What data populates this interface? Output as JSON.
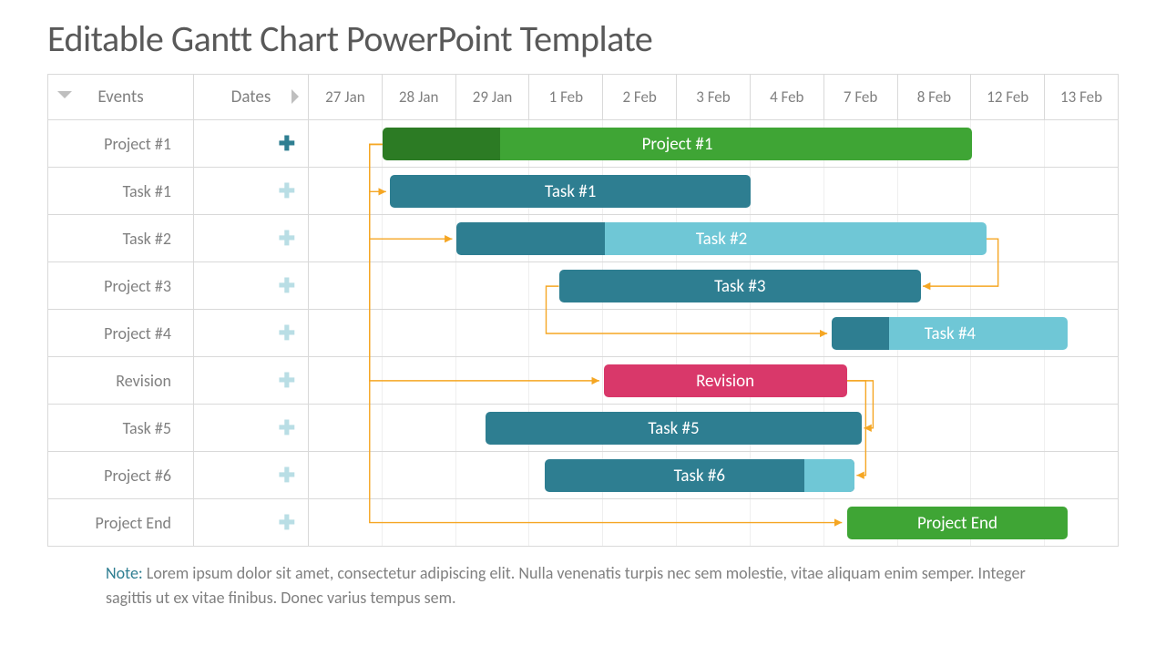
{
  "title": "Editable Gantt Chart PowerPoint Template",
  "columns": {
    "events": "Events",
    "dates": "Dates",
    "timeline": [
      "27 Jan",
      "28 Jan",
      "29 Jan",
      "1 Feb",
      "2 Feb",
      "3 Feb",
      "4 Feb",
      "7 Feb",
      "8 Feb",
      "12 Feb",
      "13 Feb"
    ]
  },
  "rows": [
    {
      "label": "Project #1",
      "plus": "dark"
    },
    {
      "label": "Task #1",
      "plus": "light"
    },
    {
      "label": "Task #2",
      "plus": "light"
    },
    {
      "label": "Project #3",
      "plus": "light"
    },
    {
      "label": "Project #4",
      "plus": "light"
    },
    {
      "label": "Revision",
      "plus": "light"
    },
    {
      "label": "Task #5",
      "plus": "light"
    },
    {
      "label": "Project #6",
      "plus": "light"
    },
    {
      "label": "Project End",
      "plus": "light"
    }
  ],
  "chart_data": {
    "type": "gantt",
    "categories": [
      "27 Jan",
      "28 Jan",
      "29 Jan",
      "1 Feb",
      "2 Feb",
      "3 Feb",
      "4 Feb",
      "7 Feb",
      "8 Feb",
      "12 Feb",
      "13 Feb"
    ],
    "bars": [
      {
        "row": 0,
        "label": "Project #1",
        "start": 1.0,
        "end": 9.0,
        "color": "#3fa535",
        "progress": 0.2,
        "progressColor": "#2c7b24"
      },
      {
        "row": 1,
        "label": "Task #1",
        "start": 1.1,
        "end": 6.0,
        "color": "#2e7e91",
        "progress": 0,
        "progressColor": "#2e7e91"
      },
      {
        "row": 2,
        "label": "Task #2",
        "start": 2.0,
        "end": 9.2,
        "color": "#6fc7d6",
        "progress": 0.28,
        "progressColor": "#2e7e91"
      },
      {
        "row": 3,
        "label": "Task #3",
        "start": 3.4,
        "end": 8.3,
        "color": "#2e7e91",
        "progress": 0,
        "progressColor": "#2e7e91"
      },
      {
        "row": 4,
        "label": "Task #4",
        "start": 7.1,
        "end": 10.3,
        "color": "#6fc7d6",
        "progress": 0.24,
        "progressColor": "#2e7e91"
      },
      {
        "row": 5,
        "label": "Revision",
        "start": 4.0,
        "end": 7.3,
        "color": "#d9386a",
        "progress": 0,
        "progressColor": "#d9386a"
      },
      {
        "row": 6,
        "label": "Task #5",
        "start": 2.4,
        "end": 7.5,
        "color": "#2e7e91",
        "progress": 0,
        "progressColor": "#2e7e91"
      },
      {
        "row": 7,
        "label": "Task #6",
        "start": 3.2,
        "end": 7.4,
        "color": "#2e7e91",
        "progress": 0,
        "progressColor": "#2e7e91",
        "tail": 0.16,
        "tailColor": "#6fc7d6"
      },
      {
        "row": 8,
        "label": "Project End",
        "start": 7.3,
        "end": 10.3,
        "color": "#3fa535",
        "progress": 0,
        "progressColor": "#3fa535"
      }
    ],
    "connectors": [
      {
        "from": {
          "row": 0,
          "col": 1.0,
          "side": "start"
        },
        "to": {
          "row": 1,
          "col": 1.1,
          "side": "start"
        }
      },
      {
        "from": {
          "row": 0,
          "col": 1.0,
          "side": "start"
        },
        "to": {
          "row": 2,
          "col": 2.0,
          "side": "start"
        }
      },
      {
        "from": {
          "row": 0,
          "col": 1.0,
          "side": "start"
        },
        "to": {
          "row": 5,
          "col": 4.0,
          "side": "start"
        }
      },
      {
        "from": {
          "row": 0,
          "col": 1.0,
          "side": "start"
        },
        "to": {
          "row": 8,
          "col": 7.3,
          "side": "start"
        }
      },
      {
        "from": {
          "row": 2,
          "col": 9.2,
          "side": "end"
        },
        "to": {
          "row": 3,
          "col": 8.3,
          "side": "end"
        }
      },
      {
        "from": {
          "row": 3,
          "col": 3.4,
          "side": "start"
        },
        "to": {
          "row": 4,
          "col": 7.1,
          "side": "start"
        }
      },
      {
        "from": {
          "row": 5,
          "col": 7.3,
          "side": "end"
        },
        "to": {
          "row": 6,
          "col": 7.5,
          "side": "end"
        }
      },
      {
        "from": {
          "row": 5,
          "col": 7.3,
          "side": "end"
        },
        "to": {
          "row": 7,
          "col": 7.4,
          "side": "end"
        }
      }
    ]
  },
  "note": {
    "label": "Note:",
    "text": " Lorem ipsum dolor sit amet, consectetur adipiscing elit. Nulla venenatis turpis nec sem molestie, vitae aliquam enim semper. Integer sagittis ut ex vitae finibus. Donec varius tempus sem."
  },
  "colors": {
    "grid": "#d9d9d9",
    "connector": "#f5a623"
  }
}
